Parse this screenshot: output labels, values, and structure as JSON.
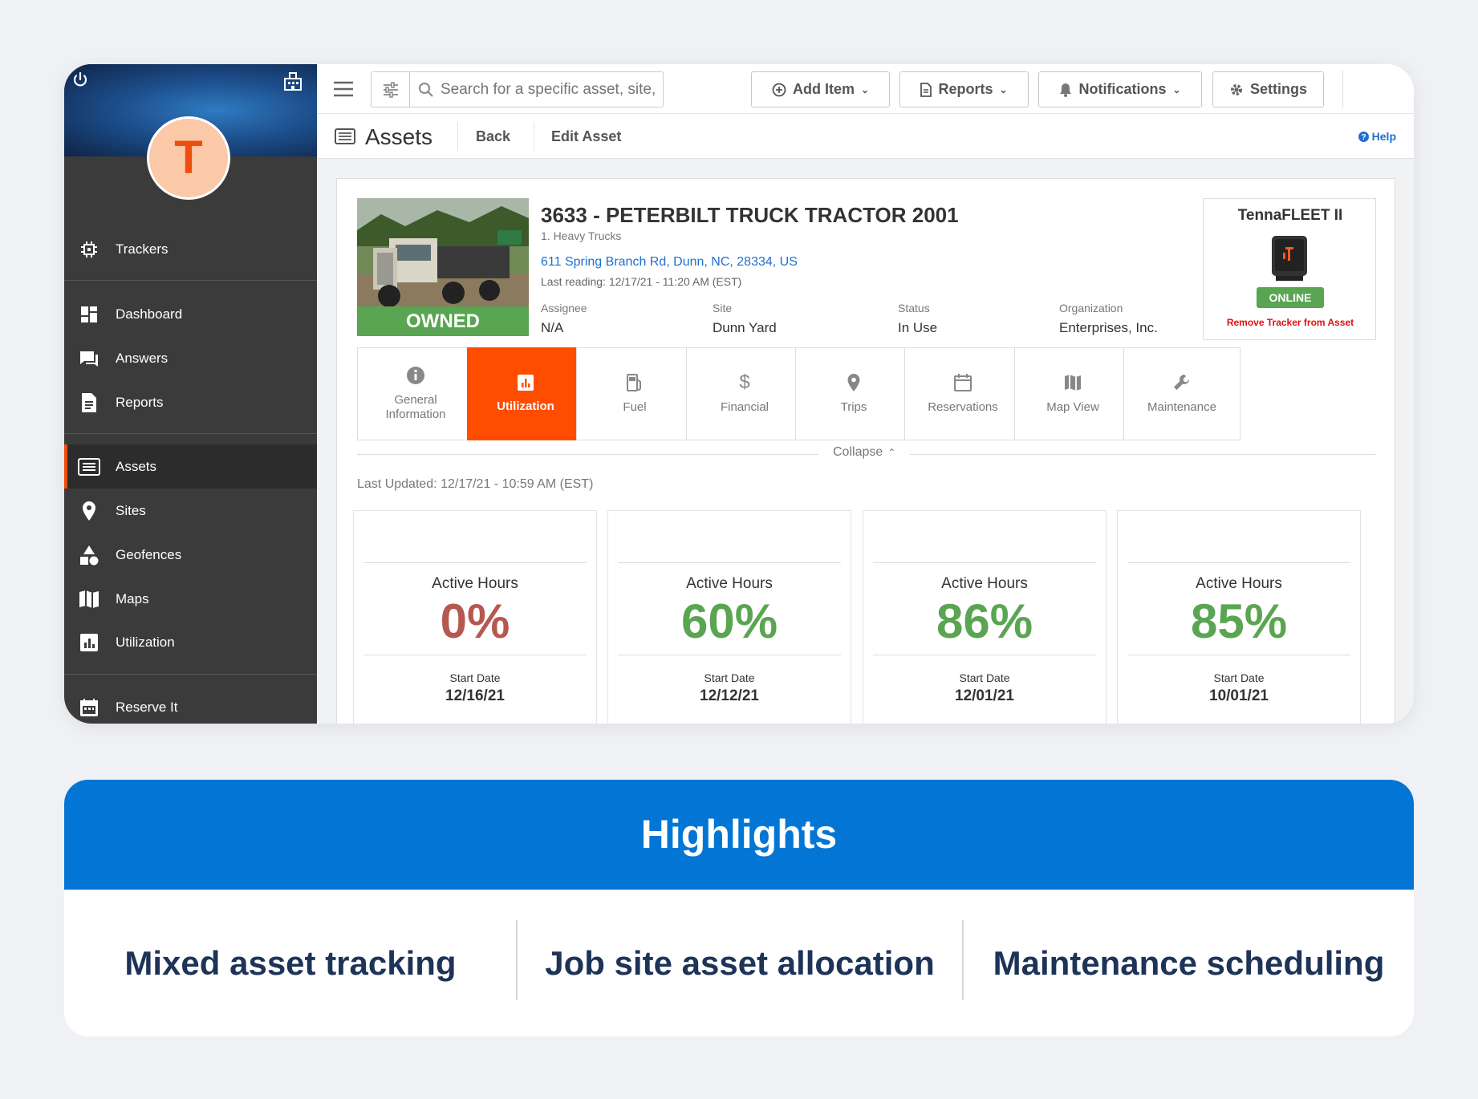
{
  "sidebar": {
    "avatar_letter": "T",
    "items": [
      {
        "label": "Trackers",
        "icon": "chip-icon"
      },
      {
        "label": "Dashboard",
        "icon": "dashboard-icon"
      },
      {
        "label": "Answers",
        "icon": "chat-icon"
      },
      {
        "label": "Reports",
        "icon": "document-icon"
      },
      {
        "label": "Assets",
        "icon": "list-icon",
        "active": true
      },
      {
        "label": "Sites",
        "icon": "pin-icon"
      },
      {
        "label": "Geofences",
        "icon": "shapes-icon"
      },
      {
        "label": "Maps",
        "icon": "map-icon"
      },
      {
        "label": "Utilization",
        "icon": "bar-chart-icon"
      },
      {
        "label": "Reserve It",
        "icon": "calendar-icon"
      }
    ]
  },
  "topbar": {
    "search_placeholder": "Search for a specific asset, site, or tracker",
    "add_item": "Add Item",
    "reports": "Reports",
    "notifications": "Notifications",
    "settings": "Settings"
  },
  "subheader": {
    "title": "Assets",
    "back": "Back",
    "edit": "Edit Asset",
    "help": "Help"
  },
  "asset": {
    "ownership": "OWNED",
    "title": "3633 - PETERBILT TRUCK TRACTOR 2001",
    "category": "1. Heavy Trucks",
    "address": "611 Spring Branch Rd, Dunn, NC, 28334, US",
    "last_reading": "Last reading: 12/17/21 - 11:20 AM (EST)",
    "meta": [
      {
        "label": "Assignee",
        "value": "N/A"
      },
      {
        "label": "Site",
        "value": "Dunn Yard"
      },
      {
        "label": "Status",
        "value": "In Use"
      },
      {
        "label": "Organization",
        "value": "Enterprises, Inc."
      }
    ]
  },
  "tracker": {
    "name": "TennaFLEET II",
    "status": "ONLINE",
    "remove": "Remove Tracker from Asset"
  },
  "tabs": [
    {
      "label": "General Information",
      "icon": "info-icon"
    },
    {
      "label": "Utilization",
      "icon": "bar-chart-icon",
      "active": true
    },
    {
      "label": "Fuel",
      "icon": "fuel-icon"
    },
    {
      "label": "Financial",
      "icon": "dollar-icon"
    },
    {
      "label": "Trips",
      "icon": "pin-icon"
    },
    {
      "label": "Reservations",
      "icon": "calendar-icon"
    },
    {
      "label": "Map View",
      "icon": "map-icon"
    },
    {
      "label": "Maintenance",
      "icon": "wrench-icon"
    }
  ],
  "collapse_label": "Collapse",
  "last_updated": "Last Updated: 12/17/21 - 10:59 AM (EST)",
  "stats": [
    {
      "label": "Active Hours",
      "value": "0%",
      "start_label": "Start Date",
      "start": "12/16/21",
      "color": "#b5584f"
    },
    {
      "label": "Active Hours",
      "value": "60%",
      "start_label": "Start Date",
      "start": "12/12/21",
      "color": "#5aa552"
    },
    {
      "label": "Active Hours",
      "value": "86%",
      "start_label": "Start Date",
      "start": "12/01/21",
      "color": "#5aa552"
    },
    {
      "label": "Active Hours",
      "value": "85%",
      "start_label": "Start Date",
      "start": "10/01/21",
      "color": "#5aa552"
    }
  ],
  "highlights": {
    "title": "Highlights",
    "items": [
      "Mixed asset tracking",
      "Job site asset allocation",
      "Maintenance scheduling"
    ]
  },
  "colors": {
    "accent": "#ff4d00",
    "online": "#5aa552",
    "link": "#1f6fd1",
    "banner": "#0376d5"
  }
}
